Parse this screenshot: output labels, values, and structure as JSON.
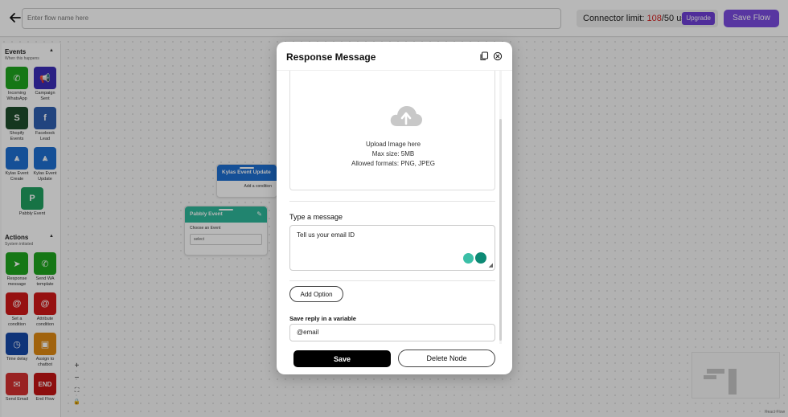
{
  "topbar": {
    "flow_name_placeholder": "Enter flow name here",
    "connector_label": "Connector limit: ",
    "connector_used": "108",
    "connector_total": "/50 used",
    "upgrade_label": "Upgrade",
    "save_flow_label": "Save Flow"
  },
  "sidebar": {
    "events_title": "Events",
    "events_subtitle": "When this happens",
    "events": [
      {
        "label": "Incoming WhatsApp",
        "icon": "whatsapp-icon",
        "color": "#1fa61f",
        "glyph": "✆"
      },
      {
        "label": "Campaign Sent",
        "icon": "megaphone-icon",
        "color": "#3b2db8",
        "glyph": "📢"
      },
      {
        "label": "Shopify Events",
        "icon": "shopify-icon",
        "color": "#1e4d2b",
        "glyph": "S"
      },
      {
        "label": "Facebook Lead",
        "icon": "facebook-icon",
        "color": "#2f5fb0",
        "glyph": "f"
      },
      {
        "label": "Kylas Event Create",
        "icon": "kylas-icon",
        "color": "#1e6fd1",
        "glyph": "⩓"
      },
      {
        "label": "Kylas Event Update",
        "icon": "kylas-icon",
        "color": "#1e6fd1",
        "glyph": "⩓"
      },
      {
        "label": "Pabbly Event",
        "icon": "pabbly-icon",
        "color": "#20a060",
        "glyph": "P"
      }
    ],
    "actions_title": "Actions",
    "actions_subtitle": "System initiated",
    "actions": [
      {
        "label": "Response message",
        "icon": "send-icon",
        "color": "#1fa61f",
        "glyph": "➤"
      },
      {
        "label": "Send WA template",
        "icon": "whatsapp-icon",
        "color": "#1fa61f",
        "glyph": "✆"
      },
      {
        "label": "Set a condition",
        "icon": "at-icon",
        "color": "#d01818",
        "glyph": "@"
      },
      {
        "label": "Attribute condition",
        "icon": "at-icon",
        "color": "#d01818",
        "glyph": "@"
      },
      {
        "label": "Time delay",
        "icon": "clock-icon",
        "color": "#1648a8",
        "glyph": "◷"
      },
      {
        "label": "Assign to chatbot",
        "icon": "robot-icon",
        "color": "#e08a12",
        "glyph": "▣"
      },
      {
        "label": "Send Email",
        "icon": "email-icon",
        "color": "#d53030",
        "glyph": "✉"
      },
      {
        "label": "End Flow",
        "icon": "end-icon",
        "color": "#c41414",
        "glyph": "END"
      }
    ]
  },
  "nodes": {
    "kylas_title": "Kylas Event Update",
    "kylas_body": "Add a condition",
    "pabbly_title": "Pabbly Event",
    "pabbly_body": "Choose an Event",
    "pabbly_select": "select"
  },
  "controls": {
    "zoom_in": "+",
    "zoom_out": "−",
    "fit": "⛶",
    "lock": "🔒"
  },
  "react_flow": "React Flow",
  "modal": {
    "title": "Response Message",
    "upload_line1": "Upload Image here",
    "upload_line2": "Max size: 5MB",
    "upload_line3": "Allowed formats: PNG, JPEG",
    "type_message_label": "Type a message",
    "message_value": "Tell us your email ID",
    "add_option_label": "Add Option",
    "save_reply_label": "Save reply in a variable",
    "variable_value": "@email",
    "save_label": "Save",
    "delete_label": "Delete Node"
  }
}
